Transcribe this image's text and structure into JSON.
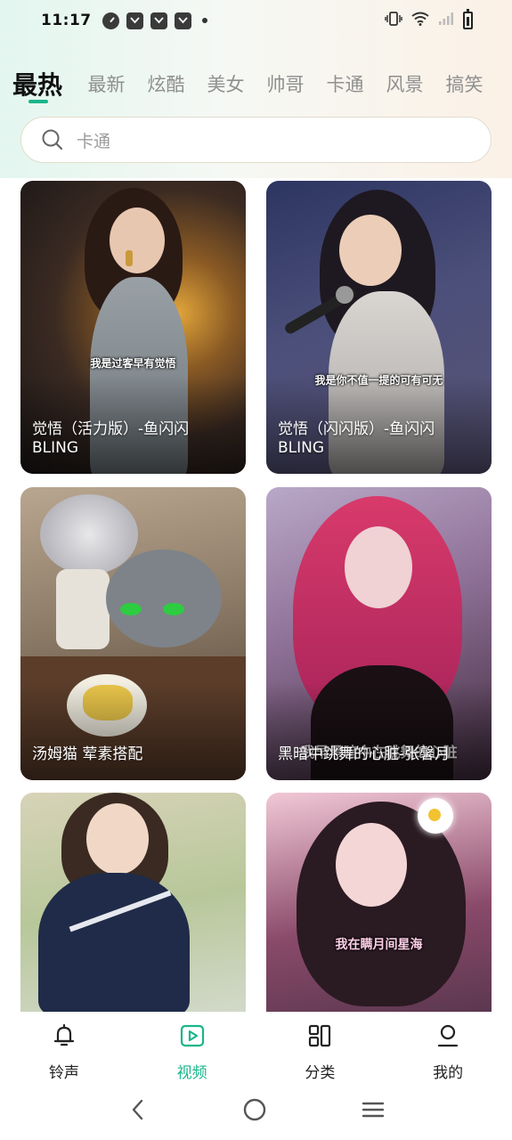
{
  "status_bar": {
    "time": "11:17"
  },
  "tabs": [
    {
      "label": "最热",
      "active": true
    },
    {
      "label": "最新",
      "active": false
    },
    {
      "label": "炫酷",
      "active": false
    },
    {
      "label": "美女",
      "active": false
    },
    {
      "label": "帅哥",
      "active": false
    },
    {
      "label": "卡通",
      "active": false
    },
    {
      "label": "风景",
      "active": false
    },
    {
      "label": "搞笑",
      "active": false
    }
  ],
  "search": {
    "placeholder": "卡通"
  },
  "cards": [
    {
      "title": "觉悟（活力版）-鱼闪闪BLING",
      "subtitle": "我是过客早有觉悟"
    },
    {
      "title": "觉悟（闪闪版）-鱼闪闪BLING",
      "subtitle": "我是你不值一提的可有可无"
    },
    {
      "title": "汤姆猫 荤素搭配",
      "subtitle": ""
    },
    {
      "title": "黑暗中跳舞的心脏-张馨月",
      "subtitle": "我早黑暗中在跳舞的心脏"
    },
    {
      "title": "",
      "subtitle": ""
    },
    {
      "title": "",
      "subtitle": "我在瞒月间星海"
    }
  ],
  "bottom_nav": [
    {
      "label": "铃声",
      "icon": "bell-icon",
      "active": false
    },
    {
      "label": "视频",
      "icon": "play-icon",
      "active": true
    },
    {
      "label": "分类",
      "icon": "grid-icon",
      "active": false
    },
    {
      "label": "我的",
      "icon": "user-icon",
      "active": false
    }
  ],
  "colors": {
    "accent": "#19b58a"
  }
}
